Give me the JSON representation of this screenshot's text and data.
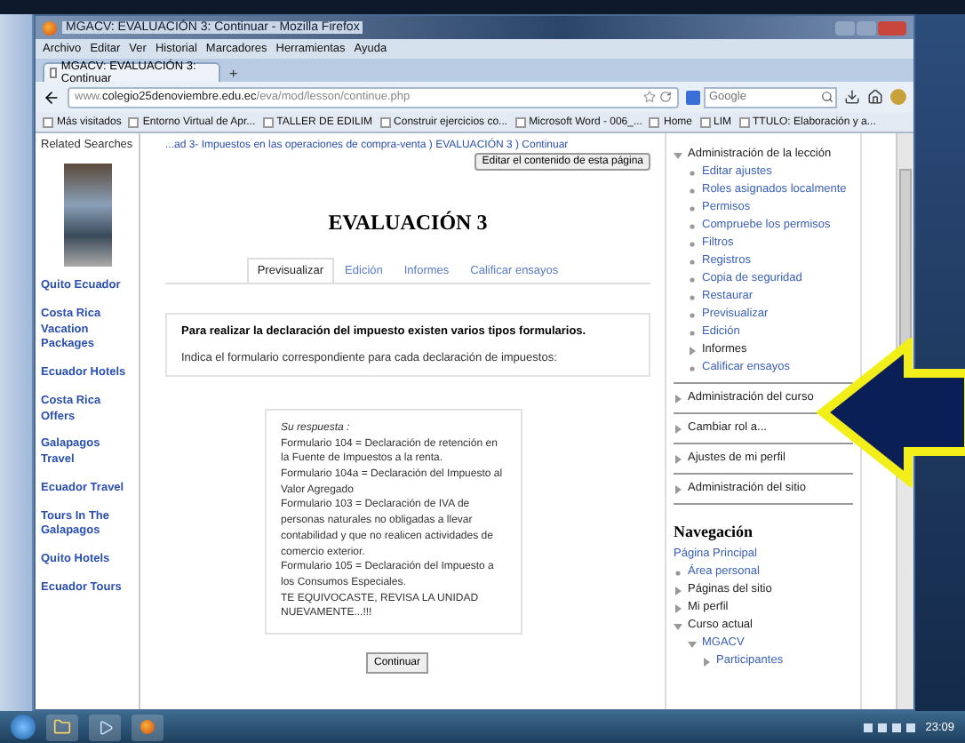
{
  "window": {
    "title": "MGACV: EVALUACIÓN 3: Continuar - Mozilla Firefox"
  },
  "menu": [
    "Archivo",
    "Editar",
    "Ver",
    "Historial",
    "Marcadores",
    "Herramientas",
    "Ayuda"
  ],
  "browser_tab": {
    "title": "MGACV: EVALUACIÓN 3: Continuar",
    "new_tab": "+"
  },
  "address_bar": {
    "url": "www.**colegio25denoviembre.edu.ec**/eva/mod/lesson/continue.php"
  },
  "search": {
    "placeholder": "Google"
  },
  "bookmarks": [
    "Más visitados",
    "Entorno Virtual de Apr...",
    "TALLER DE EDILIM",
    "Construir ejercicios co...",
    "Microsoft Word - 006_...",
    "Home",
    "LIM",
    "TTULO: Elaboración y a..."
  ],
  "sidebar": {
    "title": "Related Searches",
    "links": [
      "Quito Ecuador",
      "Costa Rica Vacation Packages",
      "Ecuador Hotels",
      "Costa Rica Offers",
      "Galapagos Travel",
      "Ecuador Travel",
      "Tours In The Galapagos",
      "Quito Hotels",
      "Ecuador Tours"
    ]
  },
  "breadcrumb": "...ad 3- Impuestos en las operaciones de compra-venta ) EVALUACIÓN 3 ) Continuar",
  "edit_button": "Editar el contenido de esta página",
  "heading": "EVALUACIÓN 3",
  "tabs": [
    {
      "label": "Previsualizar",
      "selected": true
    },
    {
      "label": "Edición",
      "selected": false
    },
    {
      "label": "Informes",
      "selected": false
    },
    {
      "label": "Calificar ensayos",
      "selected": false
    }
  ],
  "question": {
    "title": "Para realizar la declaración del impuesto existen varios tipos formularios.",
    "instruction": "Indica el formulario correspondiente para cada declaración de impuestos:"
  },
  "response": {
    "label": "Su respuesta :",
    "lines": [
      "Formulario 104 = Declaración de retención en la Fuente de Impuestos a la renta.",
      "Formulario 104a = Declaración del Impuesto al Valor Agregado",
      "Formulario 103 = Declaración de IVA de personas naturales no obligadas a llevar contabilidad y que no realicen actividades de comercio exterior.",
      "Formulario 105 = Declaración del Impuesto a los Consumos Especiales.",
      "TE EQUIVOCASTE, REVISA LA UNIDAD NUEVAMENTE...!!!"
    ]
  },
  "continue_button": "Continuar",
  "settings": [
    {
      "label": "Administración de la lección",
      "kind": "branch",
      "expanded": true,
      "children": [
        {
          "label": "Editar ajustes",
          "kind": "leaf"
        },
        {
          "label": "Roles asignados localmente",
          "kind": "leaf"
        },
        {
          "label": "Permisos",
          "kind": "leaf"
        },
        {
          "label": "Compruebe los permisos",
          "kind": "leaf"
        },
        {
          "label": "Filtros",
          "kind": "leaf"
        },
        {
          "label": "Registros",
          "kind": "leaf"
        },
        {
          "label": "Copia de seguridad",
          "kind": "leaf"
        },
        {
          "label": "Restaurar",
          "kind": "leaf"
        },
        {
          "label": "Previsualizar",
          "kind": "leaf"
        },
        {
          "label": "Edición",
          "kind": "leaf"
        },
        {
          "label": "Informes",
          "kind": "branch",
          "expanded": false
        },
        {
          "label": "Calificar ensayos",
          "kind": "leaf"
        }
      ]
    },
    {
      "label": "Administración del curso",
      "kind": "branch",
      "expanded": false
    },
    {
      "label": "Cambiar rol a...",
      "kind": "branch",
      "expanded": false
    },
    {
      "label": "Ajustes de mi perfil",
      "kind": "branch",
      "expanded": false
    },
    {
      "label": "Administración del sitio",
      "kind": "branch",
      "expanded": false
    }
  ],
  "navigation": {
    "title": "Navegación",
    "items": [
      {
        "label": "Página Principal",
        "kind": "root"
      },
      {
        "label": "Área personal",
        "kind": "leaf"
      },
      {
        "label": "Páginas del sitio",
        "kind": "branch",
        "expanded": false
      },
      {
        "label": "Mi perfil",
        "kind": "branch",
        "expanded": false
      },
      {
        "label": "Curso actual",
        "kind": "branch",
        "expanded": true,
        "children": [
          {
            "label": "MGACV",
            "kind": "branch_link",
            "expanded": true,
            "children": [
              {
                "label": "Participantes",
                "kind": "branch_link",
                "expanded": false
              }
            ]
          }
        ]
      }
    ]
  },
  "taskbar": {
    "time": "23:09"
  }
}
